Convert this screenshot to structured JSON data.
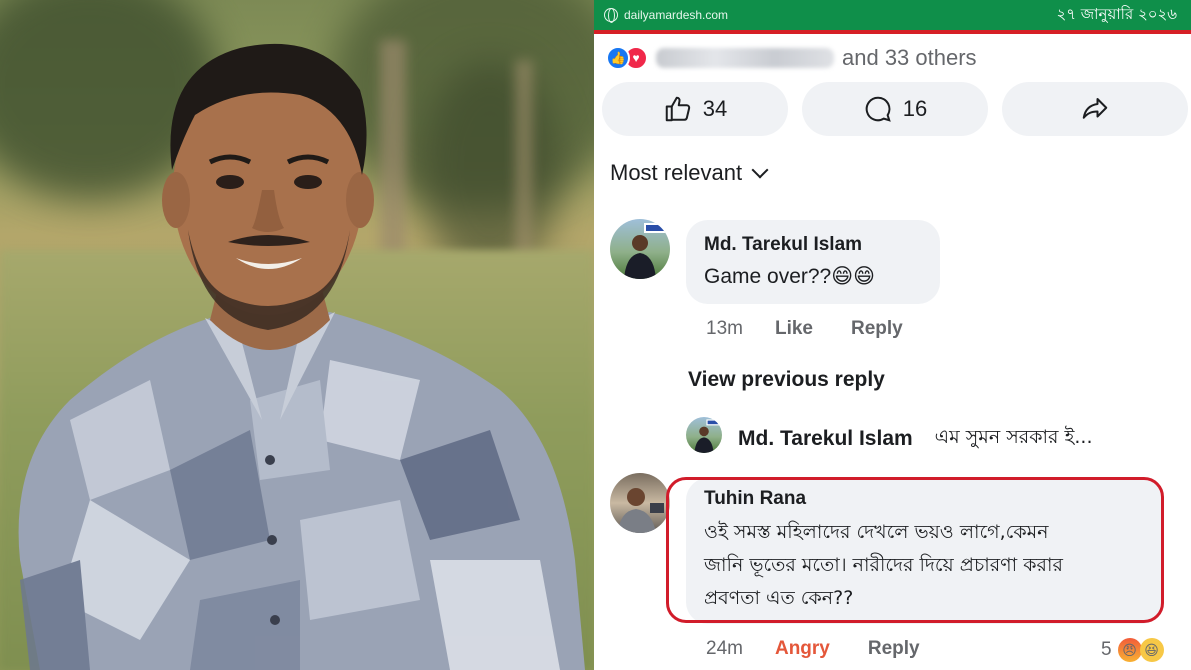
{
  "header": {
    "site": "dailyamardesh.com",
    "date": "২৭ জানুয়ারি ২০২৬",
    "colors": {
      "bar": "#0f8f4a",
      "underline": "#d61f26"
    }
  },
  "post": {
    "reactions_text": "and 33 others",
    "actions": {
      "like_count": "34",
      "comment_count": "16"
    },
    "sort_label": "Most relevant"
  },
  "comments": [
    {
      "author": "Md. Tarekul Islam",
      "text": "Game over??😄😄",
      "time": "13m",
      "like_label": "Like",
      "reply_label": "Reply"
    }
  ],
  "view_previous": "View previous reply",
  "reply_preview": {
    "author": "Md. Tarekul Islam",
    "text": "এম সুমন সরকার ই..."
  },
  "highlighted_comment": {
    "author": "Tuhin Rana",
    "lines": [
      "ওই সমস্ত মহিলাদের দেখলে ভয়ও লাগে,কেমন",
      "জানি ভূতের মতো। নারীদের দিয়ে প্রচারণা করার",
      "প্রবণতা এত কেন??"
    ],
    "time": "24m",
    "reaction_label": "Angry",
    "reply_label": "Reply",
    "reaction_count": "5",
    "highlight_color": "#d11c2a"
  }
}
